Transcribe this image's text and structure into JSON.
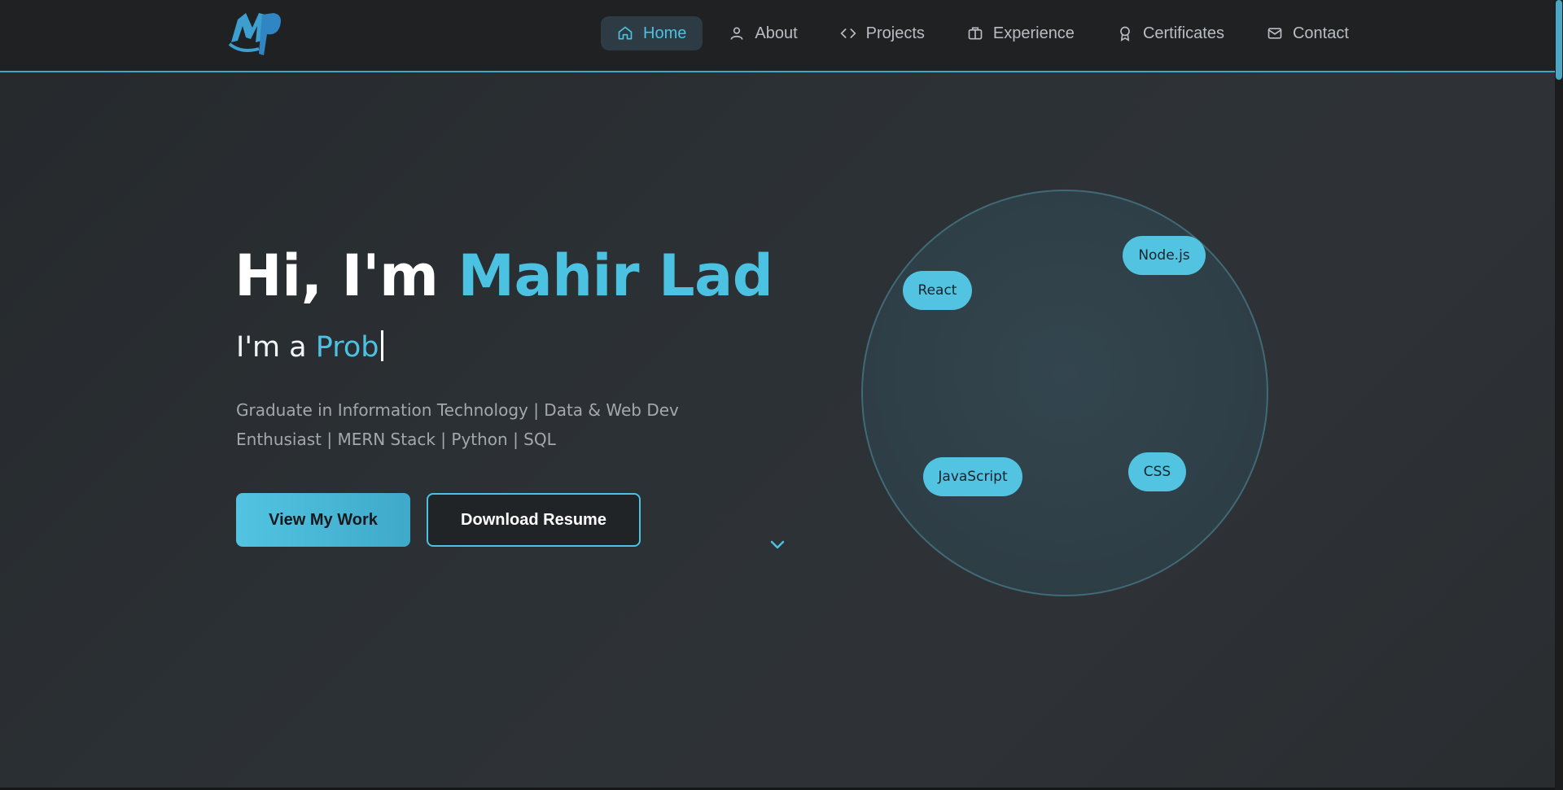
{
  "nav": {
    "items": [
      {
        "label": "Home",
        "icon": "home-icon",
        "active": true
      },
      {
        "label": "About",
        "icon": "user-icon",
        "active": false
      },
      {
        "label": "Projects",
        "icon": "code-icon",
        "active": false
      },
      {
        "label": "Experience",
        "icon": "briefcase-icon",
        "active": false
      },
      {
        "label": "Certificates",
        "icon": "award-icon",
        "active": false
      },
      {
        "label": "Contact",
        "icon": "mail-icon",
        "active": false
      }
    ]
  },
  "logo": {
    "text": "MP"
  },
  "hero": {
    "greeting": "Hi, I'm ",
    "name": "Mahir Lad",
    "subtitle_prefix": "I'm a ",
    "typed_text": "Prob",
    "description": "Graduate in Information Technology | Data & Web Dev Enthusiast | MERN Stack | Python | SQL",
    "primary_button": "View My Work",
    "secondary_button": "Download Resume",
    "scroll_icon": "chevron-down-icon"
  },
  "skills": [
    "React",
    "Node.js",
    "JavaScript",
    "CSS"
  ],
  "colors": {
    "accent": "#4cc2e2",
    "background": "#2a2d30",
    "header": "#1f2123",
    "text_muted": "#a3a8ad"
  }
}
